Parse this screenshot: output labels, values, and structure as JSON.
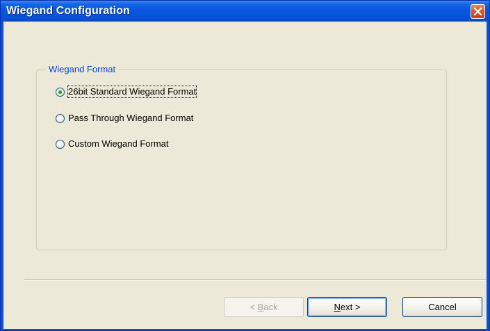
{
  "window": {
    "title": "Wiegand Configuration",
    "close_icon": "close-icon"
  },
  "group": {
    "label": "Wiegand Format",
    "options": [
      {
        "label": "26bit Standard Wiegand Format",
        "checked": true
      },
      {
        "label": "Pass Through Wiegand Format",
        "checked": false
      },
      {
        "label": "Custom Wiegand Format",
        "checked": false
      }
    ]
  },
  "buttons": {
    "back": {
      "pre": "< ",
      "accel": "B",
      "post": "ack",
      "enabled": false
    },
    "next": {
      "pre": "",
      "accel": "N",
      "post": "ext >",
      "enabled": true
    },
    "cancel": {
      "label": "Cancel",
      "enabled": true
    }
  },
  "colors": {
    "titlebar": "#0a58de",
    "client": "#ece9d8",
    "group_label": "#0046d5",
    "radio_dot": "#21a121"
  }
}
